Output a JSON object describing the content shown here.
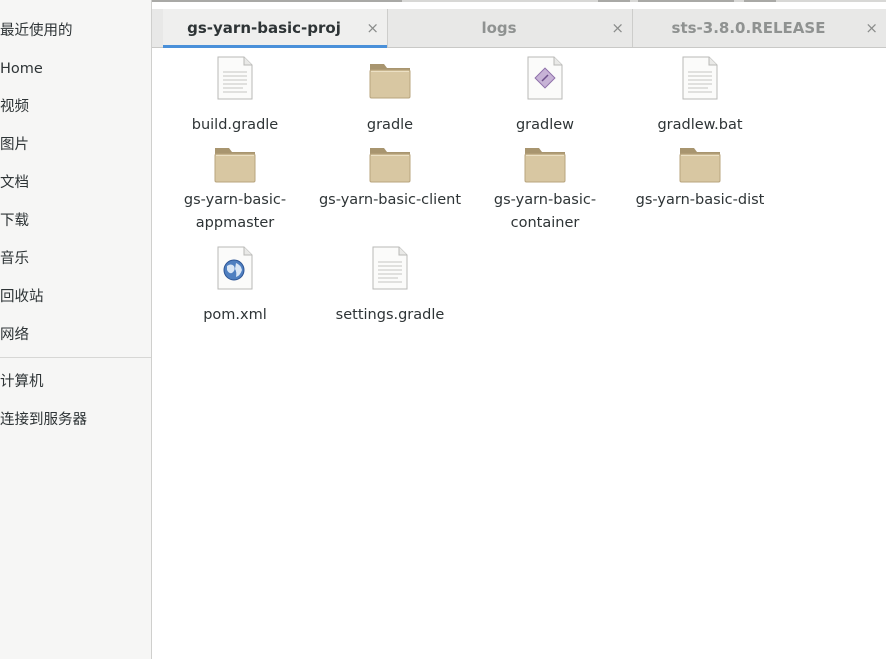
{
  "sidebar": {
    "items": [
      {
        "label": "最近使用的"
      },
      {
        "label": "Home"
      },
      {
        "label": "视频"
      },
      {
        "label": "图片"
      },
      {
        "label": "文档"
      },
      {
        "label": "下载"
      },
      {
        "label": "音乐"
      },
      {
        "label": "回收站"
      },
      {
        "label": "网络"
      },
      {
        "label": "计算机"
      },
      {
        "label": "连接到服务器"
      }
    ]
  },
  "tabs": [
    {
      "label": "gs-yarn-basic-proj",
      "close": "×",
      "active": true
    },
    {
      "label": "logs",
      "close": "×",
      "active": false
    },
    {
      "label": "sts-3.8.0.RELEASE",
      "close": "×",
      "active": false
    }
  ],
  "files": [
    {
      "line1": "build.gradle",
      "line2": "",
      "icon": "text-file-icon"
    },
    {
      "line1": "gradle",
      "line2": "",
      "icon": "folder-icon"
    },
    {
      "line1": "gradlew",
      "line2": "",
      "icon": "script-file-icon"
    },
    {
      "line1": "gradlew.bat",
      "line2": "",
      "icon": "text-file-icon"
    },
    {
      "line1": "gs-yarn-basic-",
      "line2": "appmaster",
      "icon": "folder-icon"
    },
    {
      "line1": "gs-yarn-basic-client",
      "line2": "",
      "icon": "folder-icon"
    },
    {
      "line1": "gs-yarn-basic-",
      "line2": "container",
      "icon": "folder-icon"
    },
    {
      "line1": "gs-yarn-basic-dist",
      "line2": "",
      "icon": "folder-icon"
    },
    {
      "line1": "pom.xml",
      "line2": "",
      "icon": "xml-globe-file-icon"
    },
    {
      "line1": "settings.gradle",
      "line2": "",
      "icon": "text-file-icon"
    }
  ],
  "colors": {
    "accent": "#4a90d9",
    "folder": "#d8c7a2",
    "folder_tab": "#a8956f"
  }
}
